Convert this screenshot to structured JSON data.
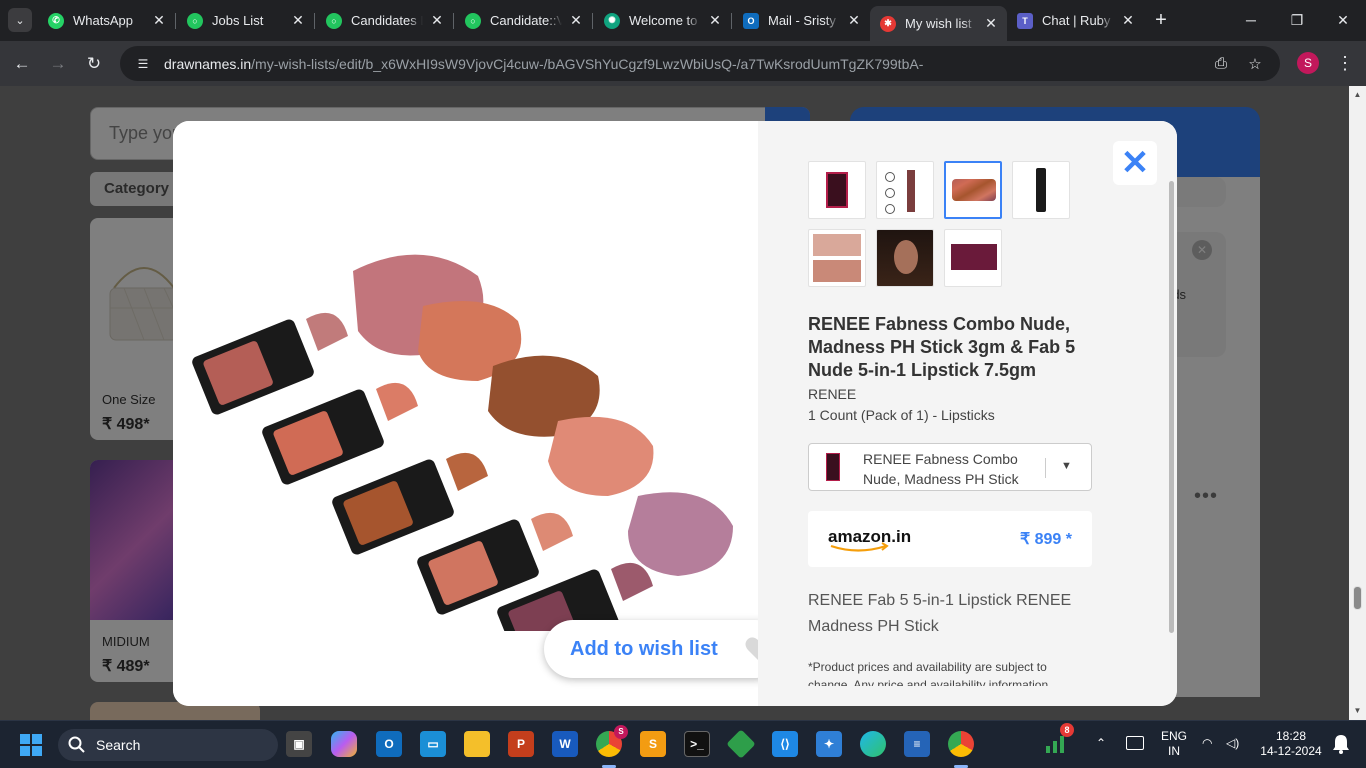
{
  "browser": {
    "tabs": [
      {
        "title": "WhatsApp",
        "icon": "whatsapp-icon",
        "color": "#25d366",
        "active": false
      },
      {
        "title": "Jobs List",
        "icon": "jobs-icon",
        "color": "#22c55e",
        "active": false
      },
      {
        "title": "Candidates List",
        "icon": "candidates-icon",
        "color": "#22c55e",
        "active": false
      },
      {
        "title": "Candidate::View",
        "icon": "candidate-icon",
        "color": "#22c55e",
        "active": false
      },
      {
        "title": "Welcome to",
        "icon": "chatgpt-icon",
        "color": "#10a37f",
        "active": false
      },
      {
        "title": "Mail - Sristy",
        "icon": "outlook-icon",
        "color": "#0f6cbd",
        "active": false
      },
      {
        "title": "My wish list",
        "icon": "drawnames-icon",
        "color": "#e53935",
        "active": true
      },
      {
        "title": "Chat | Ruby S",
        "icon": "teams-icon",
        "color": "#5b5fc7",
        "active": false
      }
    ],
    "url_host": "drawnames.in",
    "url_path": "/my-wish-lists/edit/b_x6WxHI9sW9VjovCj4cuw-/bAGVShYuCgzf9LwzWbiUsQ-/a7TwKsrodUumTgZK799tbA-",
    "profile_initial": "S"
  },
  "background": {
    "search_placeholder": "Type you",
    "category_label": "Category",
    "cards": [
      {
        "caption": "One Size",
        "price": "₹ 498*"
      },
      {
        "caption": "MIDIUM",
        "price": "₹ 489*"
      }
    ],
    "side_fragment": "rds"
  },
  "modal": {
    "product_title": "RENEE Fabness Combo Nude, Madness PH Stick 3gm & Fab 5 Nude 5-in-1 Lipstick 7.5gm",
    "brand": "RENEE",
    "count": "1 Count (Pack of 1) - Lipsticks",
    "variant_label": "RENEE Fabness Combo Nude, Madness PH Stick",
    "store": "amazon.in",
    "price": "₹ 899 *",
    "description": "RENEE Fab 5 5-in-1 Lipstick RENEE Madness PH Stick",
    "disclaimer": "*Product prices and availability are subject to change. Any price and availability information",
    "add_to_wishlist_label": "Add to wish list",
    "accent_color": "#3b82f6",
    "selected_thumbnail": 3
  },
  "taskbar": {
    "search_label": "Search",
    "language": "ENG",
    "region": "IN",
    "time": "18:28",
    "date": "14-12-2024",
    "notification_count": "8",
    "chrome_badge": "S"
  }
}
